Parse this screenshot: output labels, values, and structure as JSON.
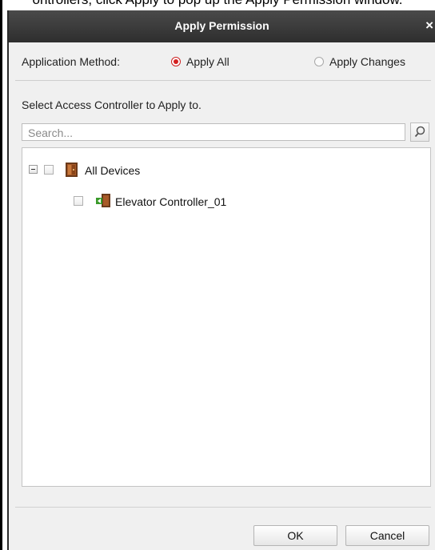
{
  "background": {
    "caption_fragment": "ontrollers, click Apply to pop up the Apply Permission window."
  },
  "dialog": {
    "title": "Apply Permission",
    "close_glyph": "×",
    "method_label": "Application Method:",
    "options": [
      {
        "label": "Apply All",
        "selected": true
      },
      {
        "label": "Apply Changes",
        "selected": false
      }
    ],
    "select_label": "Select Access Controller to Apply to.",
    "search": {
      "placeholder": "Search...",
      "value": "",
      "icon": "search-icon"
    },
    "tree": [
      {
        "label": "All Devices",
        "level": 0,
        "expanded": true,
        "checked": false,
        "icon": "door-icon"
      },
      {
        "label": "Elevator Controller_01",
        "level": 1,
        "checked": false,
        "icon": "elevator-controller-icon"
      }
    ],
    "buttons": {
      "ok": "OK",
      "cancel": "Cancel"
    }
  },
  "colors": {
    "titlebar": "#3a3a3a",
    "dialog_bg": "#f0f0f0",
    "radio_selected": "#d42020"
  }
}
